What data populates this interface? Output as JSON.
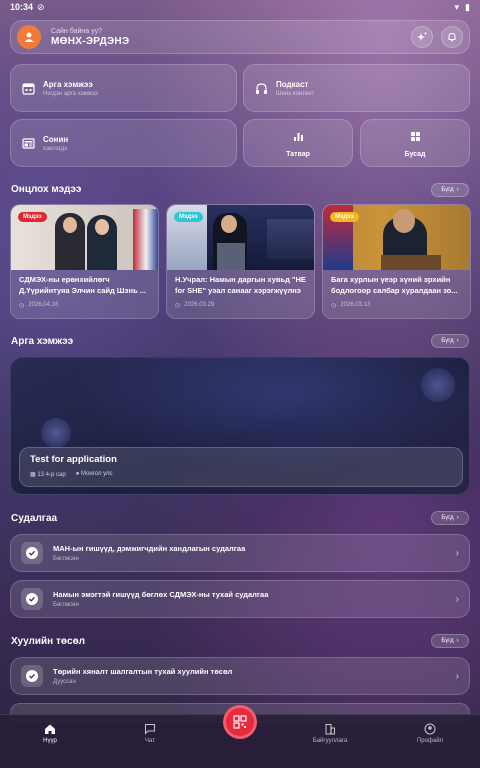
{
  "status": {
    "time": "10:34"
  },
  "header": {
    "greeting": "Сайн байна уу?",
    "user_name": "МӨНХ-ЭРДЭНЭ"
  },
  "tiles": {
    "events": {
      "title": "Арга хэмжээ",
      "subtitle": "Нэгдэн арга хэмжээ"
    },
    "podcast": {
      "title": "Подкаст",
      "subtitle": "Шинэ контент"
    },
    "newspaper": {
      "title": "Сонин",
      "subtitle": "хэвлэгдэ"
    },
    "stats": {
      "title": "Татвар"
    },
    "other": {
      "title": "Бусад"
    }
  },
  "news_section": {
    "title": "Онцлох мэдээ",
    "more_label": "Бүгд",
    "items": [
      {
        "badge": "Мэдээ",
        "badge_color": "#e2252e",
        "text": "СДМЭХ-ны ерөнхийлөгч Д.Үүрийнтуяа Элчин сайд Шэнь ...",
        "date": "2026.04.16"
      },
      {
        "badge": "Мэдээ",
        "badge_color": "#2dc6d6",
        "text": "Н.Учрал: Намын даргын хувьд \"НЕ for SHE\" уэал санааг хэрэгжүүлнэ",
        "date": "2026.03.29"
      },
      {
        "badge": "Мэдээ",
        "badge_color": "#f2b81d",
        "text": "Бага хурлын үеэр хүний эрхийн бодлогоор салбар хуралдаан зо...",
        "date": "2026.03.13"
      }
    ]
  },
  "events_section": {
    "title": "Арга хэмжээ",
    "more_label": "Бүгд",
    "event": {
      "title": "Test for application",
      "date": "13 4-р сар",
      "location": "Монгол улс"
    }
  },
  "survey_section": {
    "title": "Судалгаа",
    "more_label": "Бүгд",
    "items": [
      {
        "title": "МАН-ын гишүүд, дэмжигчдийн хандлагын судалгаа",
        "status": "Бөглөсөн"
      },
      {
        "title": "Намын эмэгтэй гишүүд бөглөх СДМЭХ-ны тухай судалгаа",
        "status": "Бөглөсөн"
      }
    ]
  },
  "law_section": {
    "title": "Хуулийн төсөл",
    "more_label": "Бүгд",
    "items": [
      {
        "title": "Төрийн хяналт шалгалтын тухай хуулийн төсөл",
        "status": "Дууссан"
      }
    ]
  },
  "bottom_nav": {
    "items": [
      {
        "label": "Нүүр"
      },
      {
        "label": "Чат"
      },
      {
        "label": "Байгууллага"
      },
      {
        "label": "Профайл"
      }
    ]
  }
}
